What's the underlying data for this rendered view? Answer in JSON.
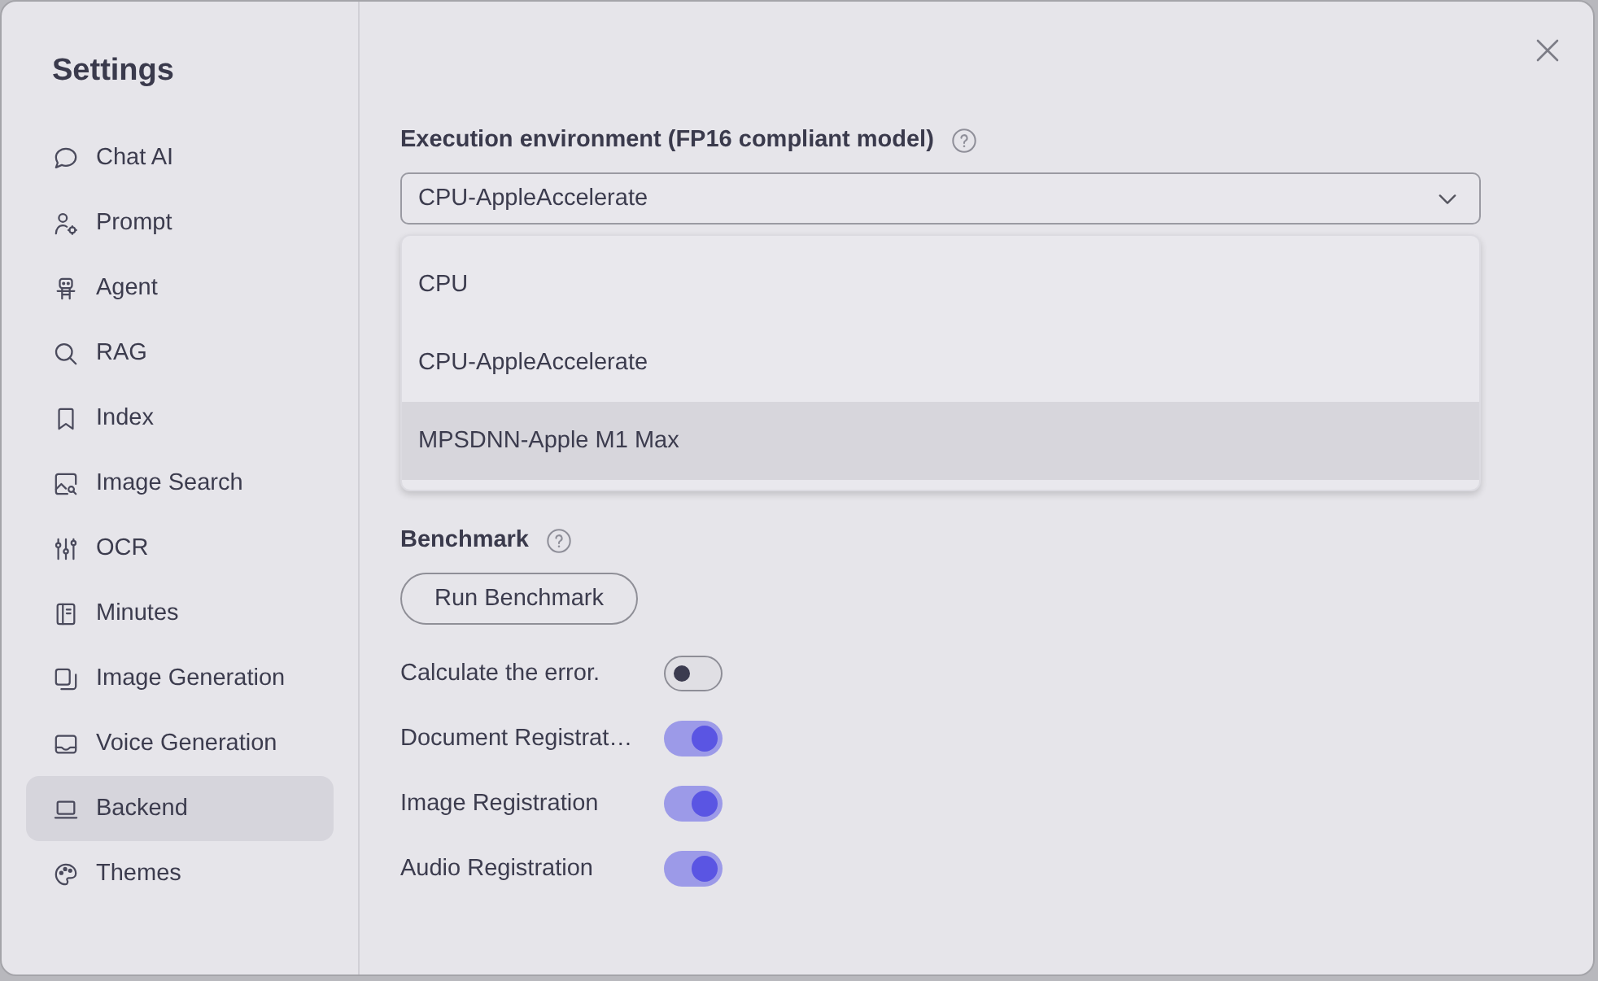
{
  "sidebar": {
    "title": "Settings",
    "items": [
      {
        "label": "Chat AI",
        "kind": "chat",
        "selected": false
      },
      {
        "label": "Prompt",
        "kind": "person",
        "selected": false
      },
      {
        "label": "Agent",
        "kind": "robot",
        "selected": false
      },
      {
        "label": "RAG",
        "kind": "search",
        "selected": false
      },
      {
        "label": "Index",
        "kind": "bookmark",
        "selected": false
      },
      {
        "label": "Image Search",
        "kind": "photo",
        "selected": false
      },
      {
        "label": "OCR",
        "kind": "sliders",
        "selected": false
      },
      {
        "label": "Minutes",
        "kind": "notebook",
        "selected": false
      },
      {
        "label": "Image Generation",
        "kind": "layers",
        "selected": false
      },
      {
        "label": "Voice Generation",
        "kind": "tray",
        "selected": false
      },
      {
        "label": "Backend",
        "kind": "laptop",
        "selected": true
      },
      {
        "label": "Themes",
        "kind": "palette",
        "selected": false
      }
    ]
  },
  "environment": {
    "label": "Execution environment (FP16 compliant model)",
    "select": {
      "value": "CPU-AppleAccelerate",
      "expanded": true
    },
    "options": [
      {
        "label": "CPU",
        "highlighted": false
      },
      {
        "label": "CPU-AppleAccelerate",
        "highlighted": false
      },
      {
        "label": "MPSDNN-Apple M1 Max",
        "highlighted": true
      }
    ]
  },
  "benchmark": {
    "label": "Benchmark",
    "button": "Run Benchmark"
  },
  "toggles": [
    {
      "label": "Calculate the error.",
      "on": false
    },
    {
      "label": "Document Registrat…",
      "on": true
    },
    {
      "label": "Image Registration",
      "on": true
    },
    {
      "label": "Audio Registration",
      "on": true
    }
  ]
}
